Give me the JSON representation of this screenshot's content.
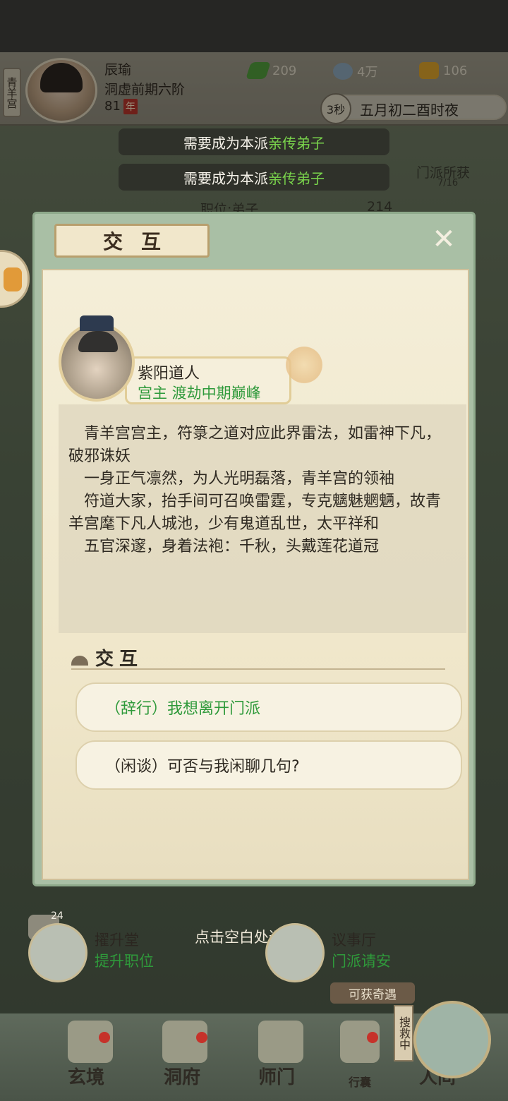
{
  "hud": {
    "sect": "青羊宫",
    "player_name": "辰瑜",
    "realm": "洞虚前期六阶",
    "age": "81",
    "age_unit": "年",
    "resources": [
      {
        "icon": "leaf-icon",
        "value": "209"
      },
      {
        "icon": "coin-icon",
        "value": "4万"
      },
      {
        "icon": "gold-icon",
        "value": "106"
      }
    ],
    "timer": "3秒",
    "date": "五月初二酉时夜"
  },
  "notices": [
    {
      "prefix": "需要成为本派",
      "highlight": "亲传弟子"
    },
    {
      "prefix": "需要成为本派",
      "highlight": "亲传弟子"
    }
  ],
  "background": {
    "sect_loot": "门派所获",
    "sect_loot_count": "7/16",
    "position": "职位:弟子",
    "contribution": "214",
    "return_hint": "点击空白处返回",
    "buildings": [
      {
        "name": "擢升堂",
        "action": "提升职位"
      },
      {
        "name": "议事厅",
        "action": "门派请安"
      }
    ],
    "chat_count": "24",
    "encounter": "可获奇遇",
    "search_tag": "搜救中",
    "nav": [
      "玄境",
      "洞府",
      "师门",
      "行囊",
      "人间"
    ]
  },
  "dialog": {
    "title": "交互",
    "npc": {
      "name": "紫阳道人",
      "title": "宫主 渡劫中期巅峰"
    },
    "description": [
      "青羊宫宫主，符箓之道对应此界雷法，如雷神下凡，破邪诛妖",
      "一身正气凛然，为人光明磊落，青羊宫的领袖",
      "符道大家，抬手间可召唤雷霆，专克魑魅魍魉，故青羊宫麾下凡人城池，少有鬼道乱世，太平祥和",
      "五官深邃，身着法袍：千秋，头戴莲花道冠"
    ],
    "section_title": "交互",
    "options": [
      {
        "label": "（辞行）我想离开门派",
        "color": "#2f9a3b"
      },
      {
        "label": "（闲谈）可否与我闲聊几句?",
        "color": "#2f2a22"
      }
    ]
  }
}
